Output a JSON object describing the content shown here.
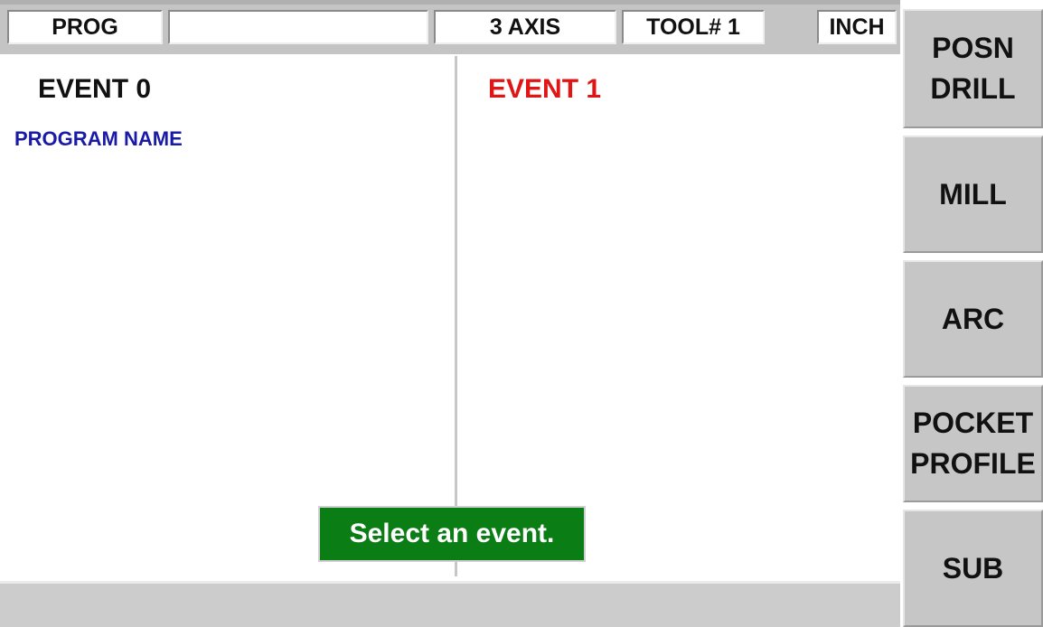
{
  "status_bar": {
    "mode": "PROG",
    "program_field": "",
    "axis": "3 AXIS",
    "tool": "TOOL# 1",
    "units": "INCH"
  },
  "events": {
    "left_title": "EVENT 0",
    "left_subtitle": "PROGRAM NAME",
    "right_title": "EVENT 1"
  },
  "message": "Select an event.",
  "softkeys": [
    {
      "line1": "POSN",
      "line2": "DRILL"
    },
    {
      "line1": "MILL",
      "line2": ""
    },
    {
      "line1": "ARC",
      "line2": ""
    },
    {
      "line1": "POCKET",
      "line2": "PROFILE"
    },
    {
      "line1": "SUB",
      "line2": ""
    }
  ],
  "colors": {
    "event_active": "#e01515",
    "program_name": "#1a1aa8",
    "message_bg": "#0a7d14",
    "button_face": "#c6c6c6"
  }
}
